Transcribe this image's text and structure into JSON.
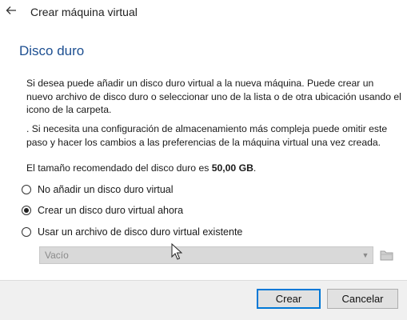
{
  "window": {
    "title": "Crear máquina virtual"
  },
  "page": {
    "heading": "Disco duro",
    "paragraph1": "Si desea puede añadir un disco duro virtual a la nueva máquina. Puede crear un nuevo archivo de disco duro o seleccionar uno de la lista o de otra ubicación usando el icono de la carpeta.",
    "paragraph2": ". Si necesita una configuración de almacenamiento más compleja puede omitir este paso y hacer los cambios a las preferencias de la máquina virtual una vez creada.",
    "recommended_prefix": "El tamaño recomendado del disco duro es ",
    "recommended_size": "50,00 GB",
    "recommended_suffix": "."
  },
  "options": [
    {
      "label": "No añadir un disco duro virtual",
      "checked": false
    },
    {
      "label": "Crear un disco duro virtual ahora",
      "checked": true
    },
    {
      "label": "Usar un archivo de disco duro virtual existente",
      "checked": false
    }
  ],
  "disk_select": {
    "value": "Vacío",
    "enabled": false
  },
  "buttons": {
    "create": "Crear",
    "cancel": "Cancelar"
  },
  "icons": {
    "back": "back-arrow-icon",
    "folder": "folder-icon",
    "dropdown": "chevron-down-icon",
    "cursor": "mouse-pointer-icon"
  },
  "colors": {
    "heading": "#1d4f91",
    "default_button_border": "#0078d7"
  }
}
